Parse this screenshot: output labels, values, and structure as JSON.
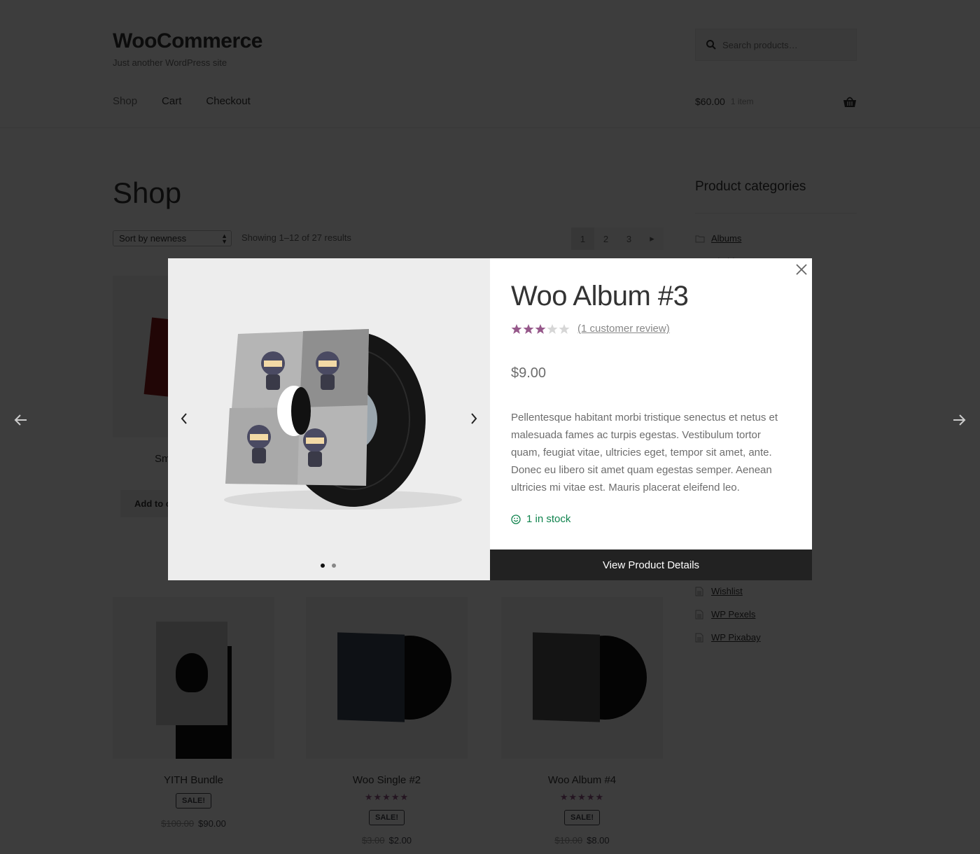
{
  "header": {
    "site_title": "WooCommerce",
    "tagline": "Just another WordPress site",
    "search_placeholder": "Search products…",
    "nav": [
      {
        "label": "Shop",
        "current": true
      },
      {
        "label": "Cart"
      },
      {
        "label": "Checkout"
      }
    ],
    "cart": {
      "amount": "$60.00",
      "count": "1 item"
    }
  },
  "shop": {
    "title": "Shop",
    "sort_selected": "Sort by newness",
    "result_count": "Showing 1–12 of 27 results",
    "pagination": {
      "pages": [
        "1",
        "2",
        "3"
      ],
      "current": "1",
      "next_icon": "▸"
    },
    "products": [
      {
        "name": "Sm…",
        "add_to_cart": "Add to c…"
      },
      {
        "name": "YITH Bundle",
        "sale_badge": "SALE!",
        "old_price": "$100.00",
        "price": "$90.00"
      },
      {
        "name": "Woo Single #2",
        "rating": 4.5,
        "stars": "★★★★★",
        "sale_badge": "SALE!",
        "old_price": "$3.00",
        "price": "$2.00"
      },
      {
        "name": "Woo Album #4",
        "rating": 5,
        "stars": "★★★★★",
        "sale_badge": "SALE!",
        "old_price": "$10.00",
        "price": "$8.00"
      }
    ]
  },
  "sidebar": {
    "categories_title": "Product categories",
    "categories": [
      "Albums",
      "Clothing"
    ],
    "pages": [
      "Wishlist",
      "WP Pexels",
      "WP Pixabay"
    ]
  },
  "quick_view": {
    "title": "Woo Album #3",
    "rating": 3,
    "rating_max": 5,
    "review_link": "(1 customer review)",
    "price": "$9.00",
    "description": "Pellentesque habitant morbi tristique senectus et netus et malesuada fames ac turpis egestas. Vestibulum tortor quam, feugiat vitae, ultricies eget, tempor sit amet, ante. Donec eu libero sit amet quam egestas semper. Aenean ultricies mi vitae est. Mauris placerat eleifend leo.",
    "stock": "1 in stock",
    "view_details_label": "View Product Details",
    "gallery": {
      "slides": 2,
      "active_slide": 1
    },
    "colors": {
      "star_filled": "#96588a",
      "star_empty": "#d6d6d6",
      "stock": "#0f834d",
      "button_bg": "#222222"
    }
  }
}
